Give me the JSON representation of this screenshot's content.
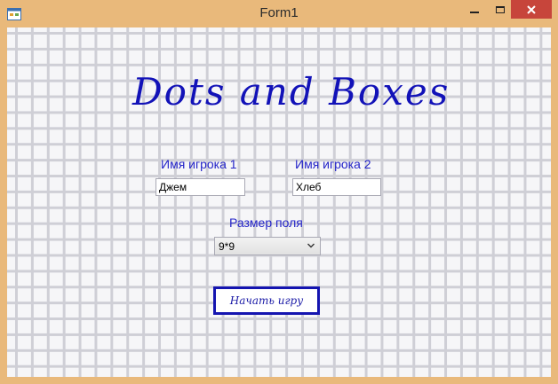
{
  "window": {
    "title": "Form1",
    "icon": "form-app-icon",
    "controls": {
      "minimize": "minimize-icon",
      "maximize": "maximize-icon",
      "close": "close-icon"
    }
  },
  "main": {
    "game_title": "Dots and Boxes",
    "player1_label": "Имя игрока 1",
    "player1_value": "Джем",
    "player2_label": "Имя игрока 2",
    "player2_value": "Хлеб",
    "board_size_label": "Размер поля",
    "board_size_value": "9*9",
    "start_button_label": "Начать игру"
  },
  "colors": {
    "frame": "#e9b97b",
    "close_button": "#c7453b",
    "accent_blue": "#1414b0",
    "grid_line": "#cfcfd6",
    "background": "#f6f6f8"
  }
}
